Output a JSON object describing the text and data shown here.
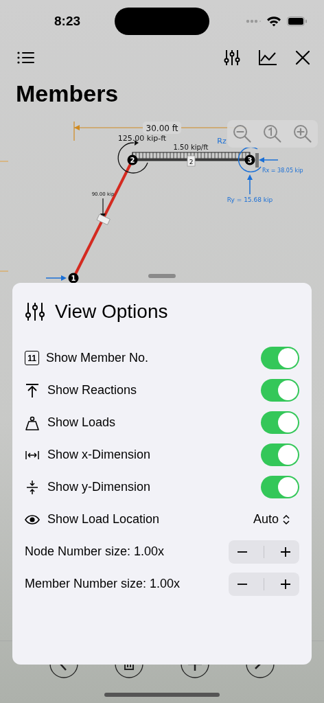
{
  "status_bar": {
    "time": "8:23"
  },
  "title": "Members",
  "diagram": {
    "span_dimension": "30.00 ft",
    "moment_load": "125.00 kip-ft",
    "distributed_load": "1.50 kip/ft",
    "member_label": "2",
    "point_load": "90.00 kip",
    "reaction_moment": "Rz",
    "reaction_x": "Rx = 38.05 kip",
    "reaction_y": "Ry = 15.68 kip",
    "nodes": [
      {
        "label": "1"
      },
      {
        "label": "2"
      },
      {
        "label": "3"
      }
    ]
  },
  "sheet": {
    "title": "View Options",
    "options": [
      {
        "kind": "toggle",
        "label": "Show Member No.",
        "badge": "11",
        "on": true
      },
      {
        "kind": "toggle",
        "label": "Show Reactions",
        "on": true
      },
      {
        "kind": "toggle",
        "label": "Show Loads",
        "on": true
      },
      {
        "kind": "toggle",
        "label": "Show x-Dimension",
        "on": true
      },
      {
        "kind": "toggle",
        "label": "Show y-Dimension",
        "on": true
      },
      {
        "kind": "picker",
        "label": "Show Load Location",
        "value": "Auto"
      },
      {
        "kind": "stepper",
        "label": "Node Number size: 1.00x"
      },
      {
        "kind": "stepper",
        "label": "Member Number size: 1.00x"
      }
    ]
  }
}
